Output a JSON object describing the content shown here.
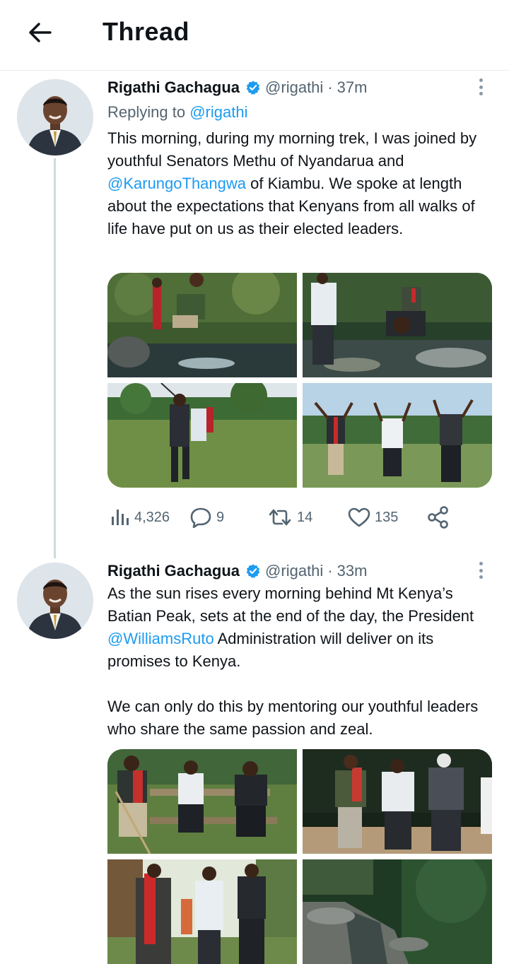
{
  "header": {
    "title": "Thread",
    "back_icon": "arrow-left-icon"
  },
  "colors": {
    "link": "#1d9bf0",
    "verified": "#1d9bf0",
    "secondary_text": "#536471",
    "thread_line": "#cfd9de"
  },
  "tweets": [
    {
      "author": "Rigathi Gachagua",
      "handle": "@rigathi",
      "dot": "·",
      "time": "37m",
      "replying_label": "Replying to",
      "replying_handle": "@rigathi",
      "text_1": "This morning, during my morning trek, I was joined by youthful Senators Methu of Nyandarua and ",
      "mention": "@KarungoThangwa",
      "text_2": " of Kiambu. We spoke at length about the expectations that Kenyans from all walks of life have put on us as their elected leaders.",
      "photo_count": 4,
      "stats": {
        "views": "4,326",
        "replies": "9",
        "retweets": "14",
        "likes": "135"
      }
    },
    {
      "author": "Rigathi Gachagua",
      "handle": "@rigathi",
      "dot": "·",
      "time": "33m",
      "text_1": "As the sun rises every morning behind Mt Kenya’s Batian Peak, sets at the end of the day, the President ",
      "mention": "@WilliamsRuto",
      "text_2": " Administration will deliver on its promises to Kenya.",
      "text_3": "We can only do this by mentoring our youthful leaders who share the same passion and zeal.",
      "photo_count": 4
    }
  ]
}
